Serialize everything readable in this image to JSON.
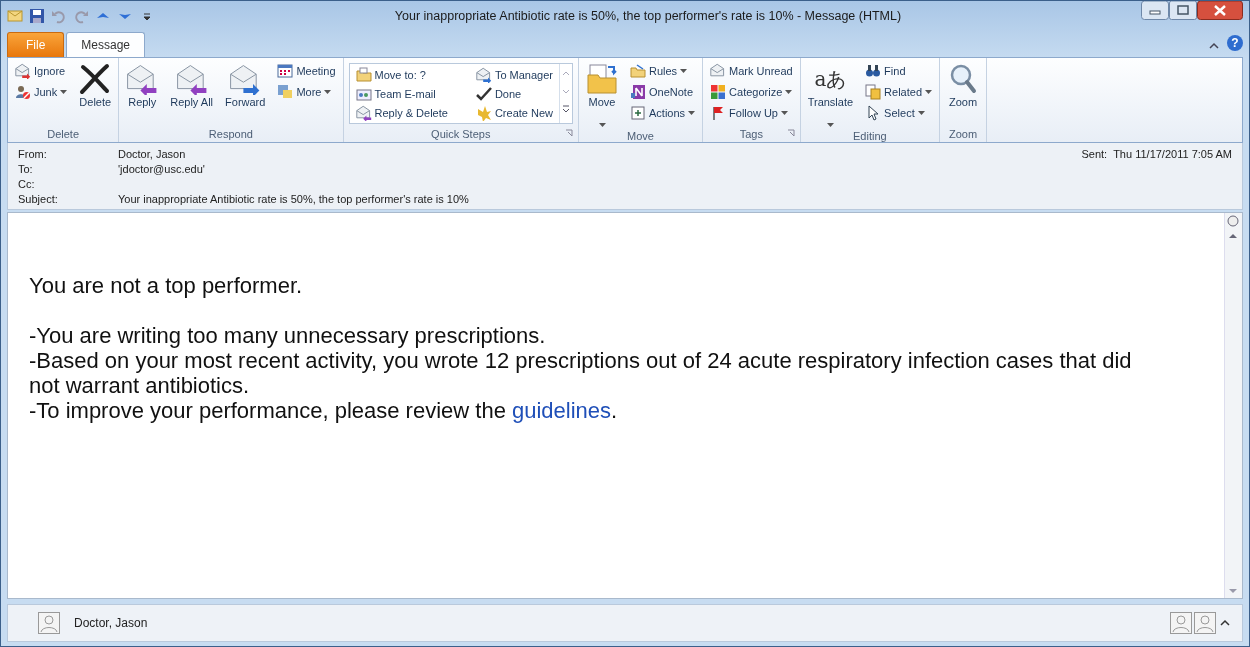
{
  "window": {
    "title": "Your inappropriate Antibiotic rate is 50%, the top performer's rate is 10%  - Message (HTML)",
    "help": "?"
  },
  "tabs": [
    {
      "label": "File",
      "kind": "file",
      "selected": false
    },
    {
      "label": "Message",
      "kind": "tab",
      "selected": true
    }
  ],
  "ribbon": {
    "groups": [
      {
        "label": "Delete",
        "launcher": false,
        "columns": [
          {
            "kind": "stack",
            "items": [
              {
                "label": "Ignore",
                "dropdown": false
              },
              {
                "label": "Junk",
                "dropdown": true
              }
            ]
          },
          {
            "kind": "large",
            "items": [
              {
                "label": "Delete",
                "dropdown": false
              }
            ]
          }
        ]
      },
      {
        "label": "Respond",
        "launcher": false,
        "columns": [
          {
            "kind": "large",
            "items": [
              {
                "label": "Reply",
                "dropdown": false
              }
            ]
          },
          {
            "kind": "large",
            "items": [
              {
                "label": "Reply All",
                "dropdown": false
              }
            ]
          },
          {
            "kind": "large",
            "items": [
              {
                "label": "Forward",
                "dropdown": false
              }
            ]
          },
          {
            "kind": "stack",
            "items": [
              {
                "label": "Meeting",
                "dropdown": false
              },
              {
                "label": "More",
                "dropdown": true
              }
            ]
          }
        ]
      },
      {
        "label": "Quick Steps",
        "launcher": true,
        "columns": [
          {
            "kind": "gallery",
            "items": [
              {
                "label": "Move to: ?",
                "dropdown": false
              },
              {
                "label": "Team E-mail",
                "dropdown": false
              },
              {
                "label": "Reply & Delete",
                "dropdown": false
              },
              {
                "label": "To Manager",
                "dropdown": false
              },
              {
                "label": "Done",
                "dropdown": false
              },
              {
                "label": "Create New",
                "dropdown": false
              }
            ]
          }
        ]
      },
      {
        "label": "Move",
        "launcher": false,
        "columns": [
          {
            "kind": "large",
            "items": [
              {
                "label": "Move",
                "dropdown": true
              }
            ]
          },
          {
            "kind": "stack",
            "items": [
              {
                "label": "Rules",
                "dropdown": true
              },
              {
                "label": "OneNote",
                "dropdown": false
              },
              {
                "label": "Actions",
                "dropdown": true
              }
            ]
          }
        ]
      },
      {
        "label": "Tags",
        "launcher": true,
        "columns": [
          {
            "kind": "stack",
            "items": [
              {
                "label": "Mark Unread",
                "dropdown": false
              },
              {
                "label": "Categorize",
                "dropdown": true
              },
              {
                "label": "Follow Up",
                "dropdown": true
              }
            ]
          }
        ]
      },
      {
        "label": "Editing",
        "launcher": false,
        "columns": [
          {
            "kind": "large",
            "items": [
              {
                "label": "Translate",
                "dropdown": true,
                "glyph": "aあ"
              }
            ]
          },
          {
            "kind": "stack",
            "items": [
              {
                "label": "Find",
                "dropdown": false
              },
              {
                "label": "Related",
                "dropdown": true
              },
              {
                "label": "Select",
                "dropdown": true
              }
            ]
          }
        ]
      },
      {
        "label": "Zoom",
        "launcher": false,
        "columns": [
          {
            "kind": "large",
            "items": [
              {
                "label": "Zoom",
                "dropdown": false
              }
            ]
          }
        ]
      }
    ]
  },
  "header": {
    "fields": [
      {
        "label": "From:",
        "value": "Doctor, Jason"
      },
      {
        "label": "To:",
        "value": "'jdoctor@usc.edu'"
      },
      {
        "label": "Cc:"
      },
      {
        "label": "Subject:",
        "value": "Your inappropriate Antibiotic rate is 50%, the top performer's rate is 10%"
      }
    ],
    "sent": {
      "label": "Sent:",
      "value": "Thu 11/17/2011 7:05 AM"
    }
  },
  "body": {
    "blocks": [
      [
        {
          "text": "You are not a top performer."
        }
      ],
      [
        {
          "text": "-You are writing too many unnecessary prescriptions."
        },
        {
          "text": "-Based on your most recent activity, you wrote 12 prescriptions out of 24 acute respiratory infection cases that did not warrant antibiotics."
        },
        {
          "text": "-To improve your performance, please review the ",
          "link": "guidelines",
          "tail": "."
        }
      ]
    ]
  },
  "people_pane": {
    "name": "Doctor, Jason"
  }
}
